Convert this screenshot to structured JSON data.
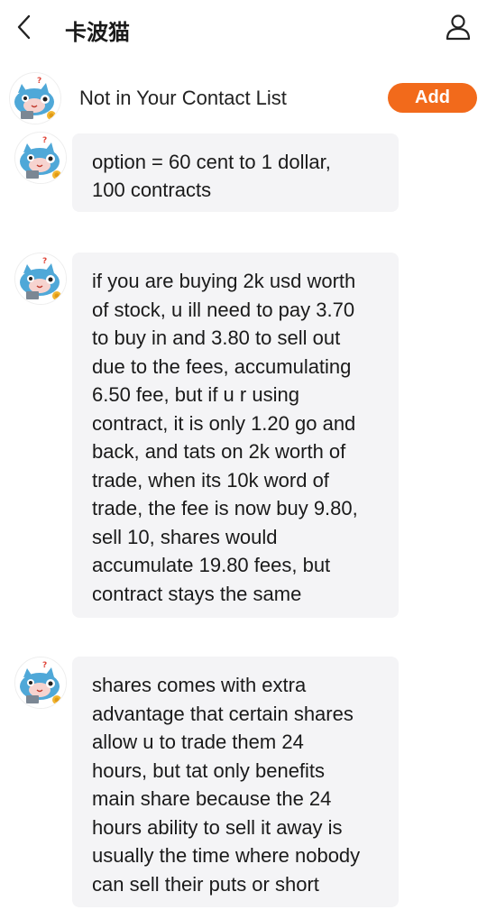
{
  "header": {
    "title": "卡波猫"
  },
  "contact_bar": {
    "text": "Not in Your Contact List",
    "add_label": "Add"
  },
  "colors": {
    "accent": "#f26a1b",
    "bubble": "#f4f4f6"
  },
  "messages": [
    {
      "text": "option = 60 cent to 1 dollar,\n100 contracts"
    },
    {
      "text": "if you are buying 2k usd worth\nof stock, u ill need to pay 3.70\nto buy in and 3.80 to sell out\ndue to the fees, accumulating\n6.50 fee, but if u r using\ncontract, it is only 1.20 go and\nback, and tats on 2k worth of\ntrade, when its 10k word of\ntrade, the fee is now buy 9.80,\nsell 10, shares would\naccumulate 19.80 fees, but\ncontract stays the same"
    },
    {
      "text": "shares comes with extra\nadvantage that certain shares\nallow u to trade them 24\nhours, but tat only benefits\nmain share because the 24\nhours ability to sell it away is\nusually the time where nobody\ncan sell their puts or short"
    }
  ]
}
